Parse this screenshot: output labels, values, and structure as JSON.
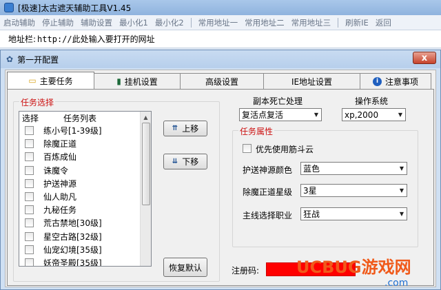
{
  "outer": {
    "title": "[极速]太古遮天辅助工具V1.45",
    "menu": [
      "启动辅助",
      "停止辅助",
      "辅助设置",
      "最小化1",
      "最小化2",
      "常用地址一",
      "常用地址二",
      "常用地址三",
      "刷新IE",
      "返回"
    ],
    "address": {
      "label": "地址栏:",
      "value": "http://此处输入要打开的网址"
    }
  },
  "dialog": {
    "title": "第一开配置",
    "close": "x",
    "tabs": [
      {
        "label": "主要任务",
        "icon": "folder-icon"
      },
      {
        "label": "挂机设置",
        "icon": "book-icon"
      },
      {
        "label": "高级设置",
        "icon": ""
      },
      {
        "label": "IE地址设置",
        "icon": ""
      },
      {
        "label": "注意事项",
        "icon": "info-icon"
      }
    ],
    "task_group_title": "任务选择",
    "list_header": {
      "select": "选择",
      "list": "任务列表"
    },
    "tasks": [
      "练小号[1-39级]",
      "除魔正道",
      "百炼成仙",
      "诛魔令",
      "护送神源",
      "仙人助凡",
      "九秘任务",
      "荒古禁地[30级]",
      "星空古路[32级]",
      "仙宠幻境[35级]",
      "妖帝圣殿[35级]"
    ],
    "buttons": {
      "move_up": "上移",
      "move_down": "下移",
      "restore": "恢复默认"
    },
    "death_label": "副本死亡处理",
    "death_value": "复活点复活",
    "os_label": "操作系统",
    "os_value": "xp,2000",
    "props_group_title": "任务属性",
    "prefer_label": "优先使用筋斗云",
    "escort_label": "护送神源颜色",
    "escort_value": "蓝色",
    "demon_label": "除魔正道星级",
    "demon_value": "3星",
    "job_label": "主线选择职业",
    "job_value": "狂战",
    "reg_label": "注册码:",
    "watermark_text": "UCBUG游戏网",
    "watermark_sub": ".com"
  },
  "colors": {
    "accent_red": "#cc1111",
    "reg_field": "#ff0000",
    "watermark_orange": "#f05a1a",
    "watermark_blue": "#1f6fd1"
  }
}
